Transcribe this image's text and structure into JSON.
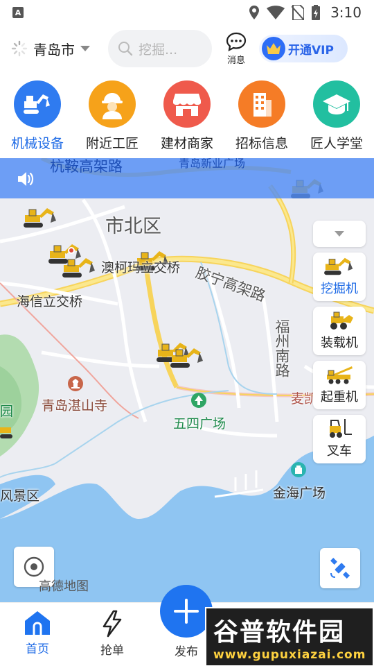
{
  "status_bar": {
    "time": "3:10",
    "badge": "A"
  },
  "header": {
    "city": "青岛市",
    "search_placeholder": "挖掘...",
    "message_label": "消息",
    "vip_label": "开通VIP"
  },
  "categories": [
    {
      "label": "机械设备",
      "icon": "excavator-icon",
      "color": "#2f7bf0"
    },
    {
      "label": "附近工匠",
      "icon": "worker-icon",
      "color": "#f6a21a"
    },
    {
      "label": "建材商家",
      "icon": "store-icon",
      "color": "#ef5a4c"
    },
    {
      "label": "招标信息",
      "icon": "building-icon",
      "color": "#f57c26"
    },
    {
      "label": "匠人学堂",
      "icon": "graduation-cap-icon",
      "color": "#22bfa0"
    }
  ],
  "map": {
    "labels": {
      "district": "市北区",
      "interchange1": "澳柯玛立交桥",
      "interchange2": "海信立交桥",
      "expressway1": "胶宁高架路",
      "expressway2": "杭鞍高架路",
      "road_fuzhou": "福州南路",
      "temple": "青岛湛山寺",
      "square": "五四广场",
      "plaza": "金海广场",
      "scenic": "风景区",
      "park": "园",
      "top_road": "青岛新业广场",
      "mai": "麦凯",
      "logo": "高德地图"
    },
    "filters": [
      {
        "label": "挖掘机",
        "icon": "excavator-icon"
      },
      {
        "label": "装载机",
        "icon": "loader-icon"
      },
      {
        "label": "起重机",
        "icon": "crane-icon"
      },
      {
        "label": "叉车",
        "icon": "forklift-icon"
      }
    ]
  },
  "tabbar": {
    "home": "首页",
    "grab": "抢单",
    "publish": "发布"
  },
  "watermark": {
    "line1": "谷普软件园",
    "line2": "www.gupuxiazai.com"
  },
  "colors": {
    "accent": "#1f6be6",
    "notice": "#508cf5"
  }
}
